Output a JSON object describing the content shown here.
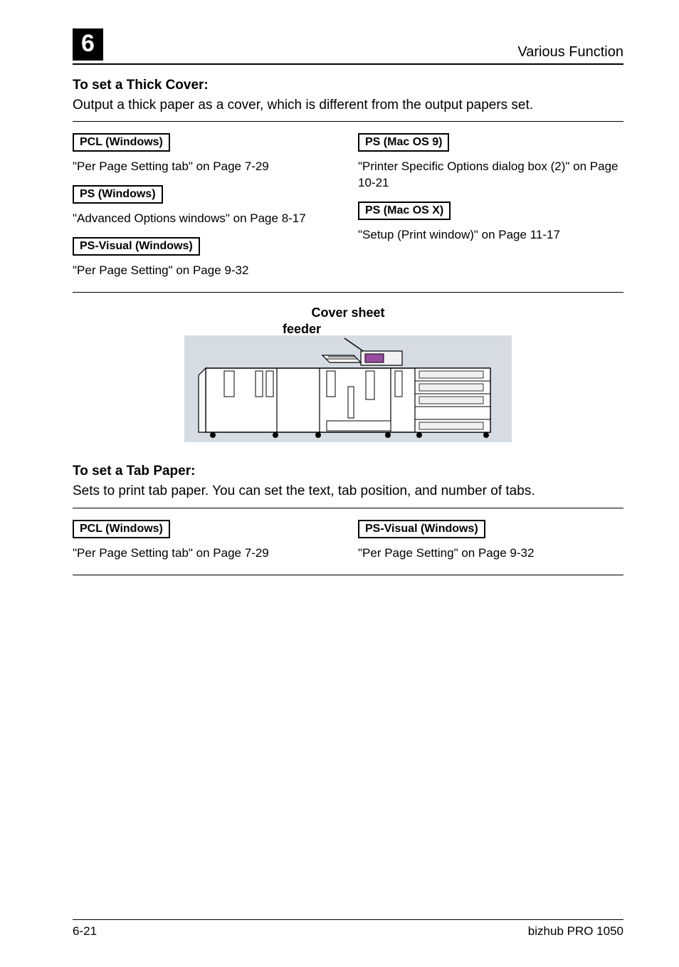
{
  "header": {
    "chapter": "6",
    "title": "Various Function"
  },
  "section1": {
    "title": "To set a Thick Cover:",
    "body": "Output a thick paper as a cover, which is different from the output papers set.",
    "left": {
      "pcl_label": "PCL (Windows)",
      "pcl_ref": "\"Per Page Setting tab\" on Page 7-29",
      "ps_label": "PS (Windows)",
      "ps_ref": "\"Advanced Options windows\" on Page 8-17",
      "psv_label": "PS-Visual (Windows)",
      "psv_ref": "\"Per Page Setting\" on Page 9-32"
    },
    "right": {
      "mac9_label": "PS (Mac OS 9)",
      "mac9_ref": "\"Printer Specific Options dialog box (2)\" on Page 10-21",
      "macx_label": "PS (Mac OS X)",
      "macx_ref": "\"Setup (Print window)\" on Page 11-17"
    }
  },
  "figure": {
    "line1": "Cover sheet",
    "line2": "feeder"
  },
  "section2": {
    "title": "To set a Tab Paper:",
    "body": "Sets to print tab paper. You can set the text, tab position, and number of tabs.",
    "left": {
      "pcl_label": "PCL (Windows)",
      "pcl_ref": "\"Per Page Setting tab\" on Page 7-29"
    },
    "right": {
      "psv_label": "PS-Visual (Windows)",
      "psv_ref": "\"Per Page Setting\" on Page 9-32"
    }
  },
  "footer": {
    "page": "6-21",
    "product": "bizhub PRO 1050"
  }
}
